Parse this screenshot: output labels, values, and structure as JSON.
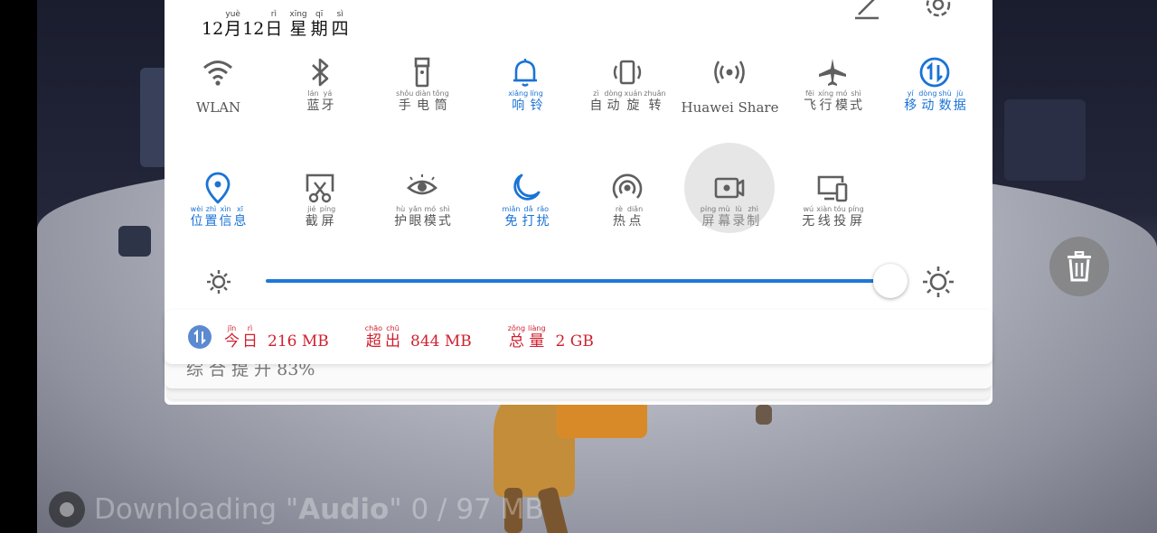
{
  "background": {
    "download_prefix": "Downloading \"",
    "download_item": "Audio",
    "download_suffix": "\" 0 / 97 MB"
  },
  "header": {
    "month_num": "12",
    "month_char": "月",
    "month_py": "yuè",
    "day_num": "12",
    "day_char": "日",
    "day_py": "rì",
    "week": [
      {
        "hz": "星",
        "py": "xīng"
      },
      {
        "hz": "期",
        "py": "qī"
      },
      {
        "hz": "四",
        "py": "sì"
      }
    ],
    "edit_icon": "edit-icon",
    "settings_icon": "gear-icon"
  },
  "toggles_row1": [
    {
      "name": "wlan",
      "icon": "wifi-icon",
      "state": "off",
      "plain": "WLAN"
    },
    {
      "name": "bluetooth",
      "icon": "bluetooth-icon",
      "state": "off",
      "chars": [
        {
          "hz": "蓝",
          "py": "lán"
        },
        {
          "hz": "牙",
          "py": "yá"
        }
      ]
    },
    {
      "name": "flashlight",
      "icon": "flashlight-icon",
      "state": "off",
      "chars": [
        {
          "hz": "手",
          "py": "shǒu"
        },
        {
          "hz": "电",
          "py": "diàn"
        },
        {
          "hz": "筒",
          "py": "tǒng"
        }
      ]
    },
    {
      "name": "ring",
      "icon": "bell-icon",
      "state": "on",
      "chars": [
        {
          "hz": "响",
          "py": "xiǎng"
        },
        {
          "hz": "铃",
          "py": "líng"
        }
      ]
    },
    {
      "name": "auto-rotate",
      "icon": "rotate-icon",
      "state": "off",
      "chars": [
        {
          "hz": "自",
          "py": "zì"
        },
        {
          "hz": "动",
          "py": "dòng"
        },
        {
          "hz": "旋",
          "py": "xuán"
        },
        {
          "hz": "转",
          "py": "zhuǎn"
        }
      ]
    },
    {
      "name": "huawei-share",
      "icon": "share-icon",
      "state": "off",
      "plain": "Huawei Share"
    },
    {
      "name": "airplane",
      "icon": "airplane-icon",
      "state": "off",
      "chars": [
        {
          "hz": "飞",
          "py": "fēi"
        },
        {
          "hz": "行",
          "py": "xíng"
        },
        {
          "hz": "模",
          "py": "mó"
        },
        {
          "hz": "式",
          "py": "shì"
        }
      ]
    },
    {
      "name": "mobile-data",
      "icon": "mobile-data-icon",
      "state": "on",
      "chars": [
        {
          "hz": "移",
          "py": "yí"
        },
        {
          "hz": "动",
          "py": "dòng"
        },
        {
          "hz": "数",
          "py": "shù"
        },
        {
          "hz": "据",
          "py": "jù"
        }
      ]
    }
  ],
  "toggles_row2": [
    {
      "name": "location",
      "icon": "location-pin-icon",
      "state": "on",
      "chars": [
        {
          "hz": "位",
          "py": "wèi"
        },
        {
          "hz": "置",
          "py": "zhì"
        },
        {
          "hz": "信",
          "py": "xìn"
        },
        {
          "hz": "息",
          "py": "xī"
        }
      ]
    },
    {
      "name": "screenshot",
      "icon": "screenshot-icon",
      "state": "off",
      "chars": [
        {
          "hz": "截",
          "py": "jié"
        },
        {
          "hz": "屏",
          "py": "píng"
        }
      ]
    },
    {
      "name": "eye-comfort",
      "icon": "eye-icon",
      "state": "off",
      "chars": [
        {
          "hz": "护",
          "py": "hù"
        },
        {
          "hz": "眼",
          "py": "yǎn"
        },
        {
          "hz": "模",
          "py": "mó"
        },
        {
          "hz": "式",
          "py": "shì"
        }
      ]
    },
    {
      "name": "do-not-disturb",
      "icon": "moon-icon",
      "state": "on",
      "chars": [
        {
          "hz": "免",
          "py": "miǎn"
        },
        {
          "hz": "打",
          "py": "dǎ"
        },
        {
          "hz": "扰",
          "py": "rǎo"
        }
      ]
    },
    {
      "name": "hotspot",
      "icon": "hotspot-icon",
      "state": "off",
      "chars": [
        {
          "hz": "热",
          "py": "rè"
        },
        {
          "hz": "点",
          "py": "diǎn"
        }
      ]
    },
    {
      "name": "screen-record",
      "icon": "screen-record-icon",
      "state": "pressed",
      "chars": [
        {
          "hz": "屏",
          "py": "píng"
        },
        {
          "hz": "幕",
          "py": "mù"
        },
        {
          "hz": "录",
          "py": "lù"
        },
        {
          "hz": "制",
          "py": "zhì"
        }
      ]
    },
    {
      "name": "wireless-projection",
      "icon": "projection-icon",
      "state": "off",
      "chars": [
        {
          "hz": "无",
          "py": "wú"
        },
        {
          "hz": "线",
          "py": "xiàn"
        },
        {
          "hz": "投",
          "py": "tóu"
        },
        {
          "hz": "屏",
          "py": "píng"
        }
      ]
    }
  ],
  "brightness": {
    "level": 0.97,
    "min_icon": "sun-small-icon",
    "max_icon": "sun-large-icon"
  },
  "data_usage": {
    "icon": "mobile-data-icon",
    "today": {
      "chars": [
        {
          "hz": "今",
          "py": "jīn"
        },
        {
          "hz": "日",
          "py": "rì"
        }
      ],
      "value": "216 MB"
    },
    "over": {
      "chars": [
        {
          "hz": "超",
          "py": "chāo"
        },
        {
          "hz": "出",
          "py": "chū"
        }
      ],
      "value": "844 MB"
    },
    "total": {
      "chars": [
        {
          "hz": "总",
          "py": "zǒng"
        },
        {
          "hz": "量",
          "py": "liàng"
        }
      ],
      "value": "2 GB"
    }
  },
  "stacked_notification": {
    "text": "综 合 提 升 83%"
  },
  "delete_button": {
    "icon": "trash-icon"
  },
  "colors": {
    "accent": "#1a73d6",
    "alert": "#d0202f",
    "icon_gray": "#5f5f5f"
  }
}
